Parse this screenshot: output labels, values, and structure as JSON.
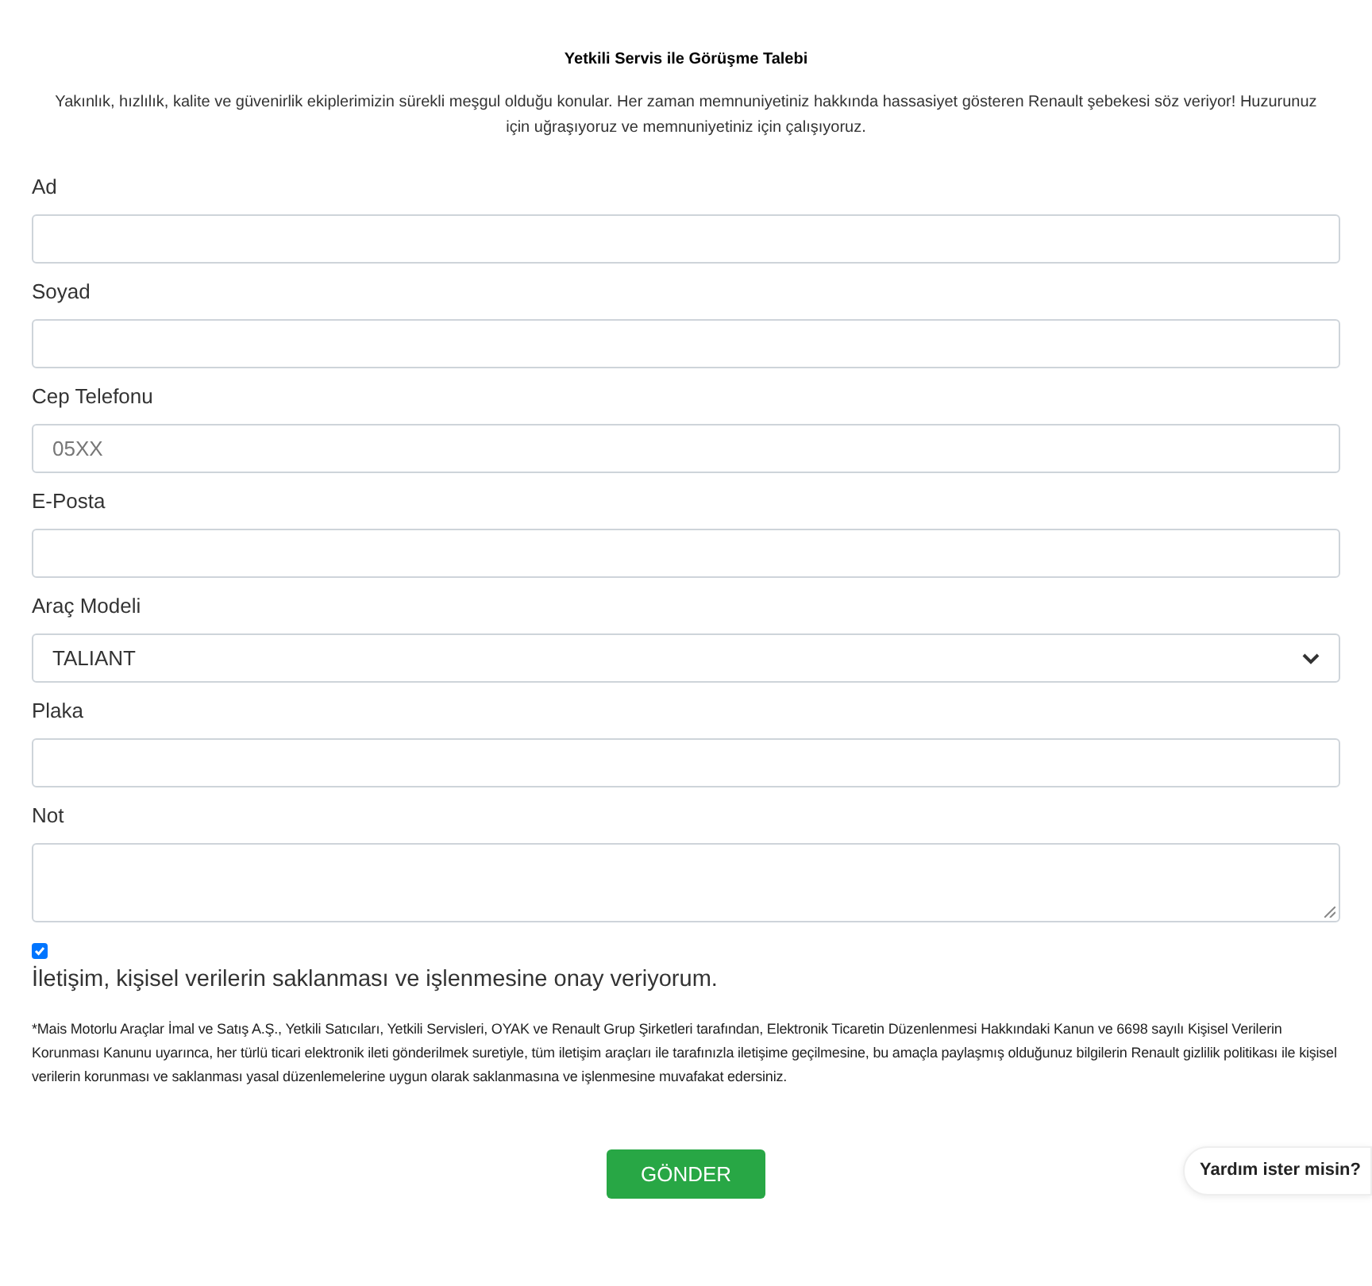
{
  "title": "Yetkili Servis ile Görüşme Talebi",
  "intro": "Yakınlık, hızlılık, kalite ve güvenirlik ekiplerimizin sürekli meşgul olduğu konular. Her zaman memnuniyetiniz hakkında hassasiyet gösteren Renault şebekesi söz veriyor! Huzurunuz için uğraşıyoruz ve memnuniyetiniz için çalışıyoruz.",
  "fields": [
    {
      "kind": "text",
      "label": "Ad"
    },
    {
      "kind": "text",
      "label": "Soyad"
    },
    {
      "kind": "text",
      "label": "Cep Telefonu",
      "placeholder": "05XX"
    },
    {
      "kind": "text",
      "label": "E-Posta"
    },
    {
      "kind": "select",
      "label": "Araç Modeli",
      "value": "TALIANT"
    },
    {
      "kind": "text",
      "label": "Plaka"
    },
    {
      "kind": "textarea",
      "label": "Not"
    }
  ],
  "consent": {
    "checked": true,
    "label": "İletişim, kişisel verilerin saklanması ve işlenmesine onay veriyorum."
  },
  "disclaimer": "*Mais Motorlu Araçlar İmal ve Satış A.Ş., Yetkili Satıcıları, Yetkili Servisleri, OYAK ve Renault Grup Şirketleri tarafından, Elektronik Ticaretin Düzenlenmesi Hakkındaki Kanun ve 6698 sayılı Kişisel Verilerin Korunması Kanunu uyarınca, her türlü ticari elektronik ileti gönderilmek suretiyle, tüm iletişim araçları ile tarafınızla iletişime geçilmesine, bu amaçla paylaşmış olduğunuz bilgilerin Renault gizlilik politikası ile kişisel verilerin korunması ve saklanması yasal düzenlemelerine uygun olarak saklanmasına ve işlenmesine muvafakat edersiniz.",
  "submit": "GÖNDER",
  "help": "Yardım ister misin?"
}
